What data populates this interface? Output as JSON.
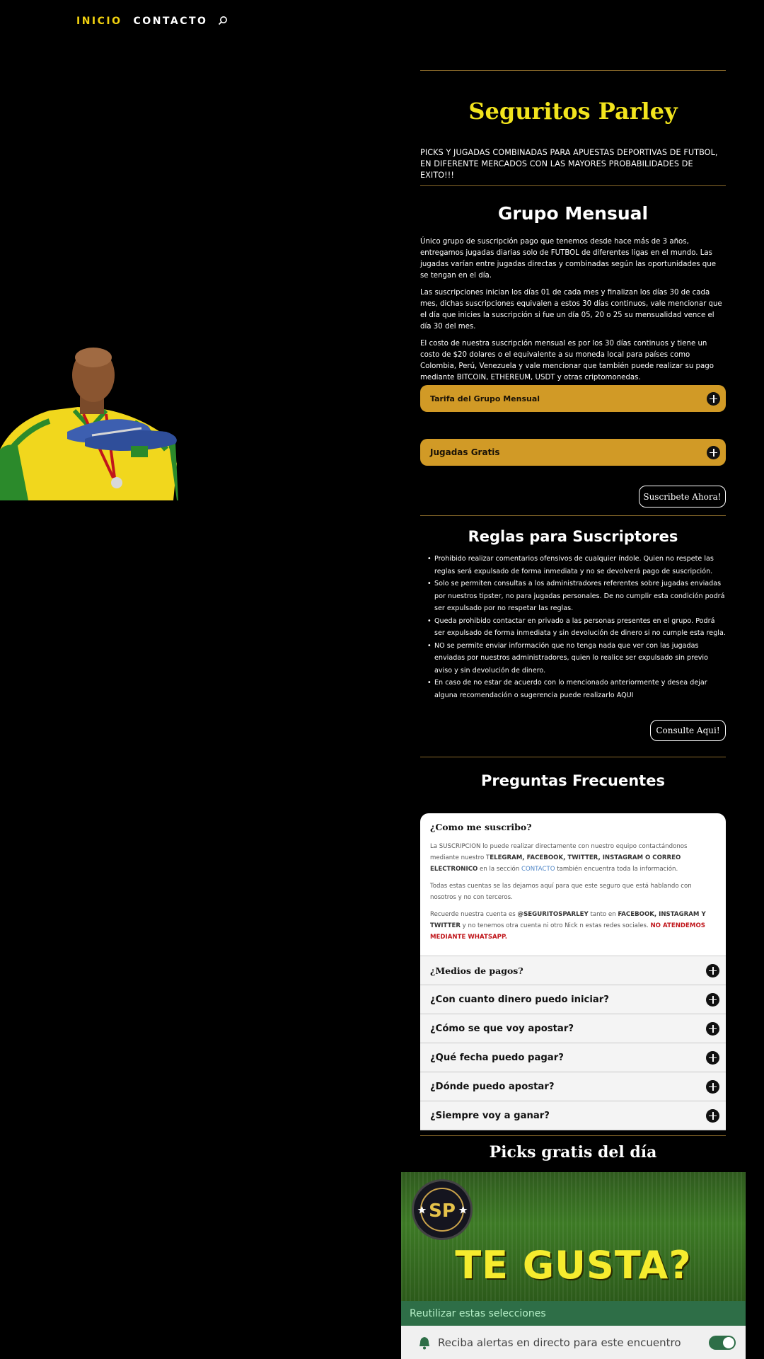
{
  "nav": {
    "items": [
      {
        "label": "INICIO",
        "active": true
      },
      {
        "label": "CONTACTO",
        "active": false
      }
    ],
    "search_icon": "search-icon"
  },
  "hero": {
    "title": "Seguritos Parley",
    "intro": "PICKS Y JUGADAS COMBINADAS PARA APUESTAS DEPORTIVAS DE FUTBOL, EN DIFERENTE MERCADOS CON LAS MAYORES PROBABILIDADES DE EXITO!!!"
  },
  "monthly": {
    "title": "Grupo Mensual",
    "paragraphs": [
      "Único grupo de suscripción pago que tenemos desde hace más de 3 años, entregamos jugadas diarias solo de FUTBOL de diferentes ligas en el mundo. Las jugadas varían entre jugadas directas y combinadas según las oportunidades que se tengan en el día.",
      "Las suscripciones inician los días 01 de cada mes y finalizan los días 30 de cada mes, dichas suscripciones equivalen a estos 30 días continuos, vale mencionar que el día que inicies la suscripción si fue un día 05, 20 o 25 su mensualidad vence el día 30 del mes.",
      "El costo de nuestra suscripción mensual es por los 30 días continuos y tiene un costo de $20 dolares o el equivalente a su moneda local para países como Colombia, Perú, Venezuela y vale mencionar que también puede realizar su pago mediante BITCOIN, ETHEREUM, USDT y otras criptomonedas."
    ],
    "accordion_1": "Tarifa del Grupo Mensual",
    "accordion_2": "Jugadas Gratis",
    "subscribe_button": "Suscribete Ahora!"
  },
  "rules": {
    "title": "Reglas para Suscriptores",
    "items": [
      "Prohibido realizar comentarios ofensivos de cualquier índole. Quien no respete las reglas será expulsado de forma inmediata y no se devolverá pago de suscripción.",
      "Solo se permiten consultas a los administradores referentes sobre jugadas enviadas por nuestros tipster, no para jugadas personales. De no cumplir esta condición podrá ser expulsado por no respetar las reglas.",
      "Queda prohibido contactar en privado a las personas presentes en el grupo. Podrá ser expulsado de forma inmediata y sin devolución de dinero si no cumple esta regla.",
      "NO se permite enviar información que no tenga nada que ver con las jugadas enviadas por nuestros administradores, quien lo realice ser expulsado sin previo aviso y sin devolución de dinero.",
      "En caso de no estar de acuerdo con lo mencionado anteriormente y desea dejar alguna recomendación o sugerencia puede realizarlo AQUI"
    ],
    "consult_button": "Consulte Aqui!"
  },
  "faq": {
    "title": "Preguntas Frecuentes",
    "open_question": "¿Como me suscribo?",
    "p1_a": "La SUSCRIPCION lo puede realizar directamente con nuestro equipo contactándonos mediante nuestro T",
    "p1_b": "ELEGRAM, FACEBOOK, TWITTER, INSTAGRAM O CORREO ELECTRONICO",
    "p1_c": " en la sección ",
    "p1_link": "CONTACTO",
    "p1_d": " también encuentra toda la información.",
    "p2": "Todas estas cuentas se las dejamos aquí para que este seguro que está hablando con nosotros y no con terceros.",
    "p3_a": "Recuerde nuestra cuenta es ",
    "p3_b": "@SEGURITOSPARLEY",
    "p3_c": " tanto en ",
    "p3_d": "FACEBOOK, INSTAGRAM Y TWITTER",
    "p3_e": " y no tenemos otra cuenta ni otro Nick n estas redes sociales. ",
    "p3_red": "NO ATENDEMOS MEDIANTE WHATSAPP.",
    "questions": [
      "¿Medios de pagos?",
      "¿Con cuanto dinero puedo iniciar?",
      "¿Cómo se que voy apostar?",
      "¿Qué fecha puedo pagar?",
      "¿Dónde puedo apostar?",
      "¿Siempre voy a ganar?"
    ]
  },
  "picks": {
    "title": "Picks gratis del día",
    "promo_text": "TE GUSTA?",
    "logo_letters": "SP",
    "reuse_text": "Reutilizar estas selecciones",
    "alert_text": "Reciba alertas en directo para este encuentro"
  },
  "colors": {
    "accent_yellow": "#f2e41d",
    "gold": "#d19a26",
    "rule": "#8a6a2a",
    "green_bar": "#2e6e47"
  }
}
